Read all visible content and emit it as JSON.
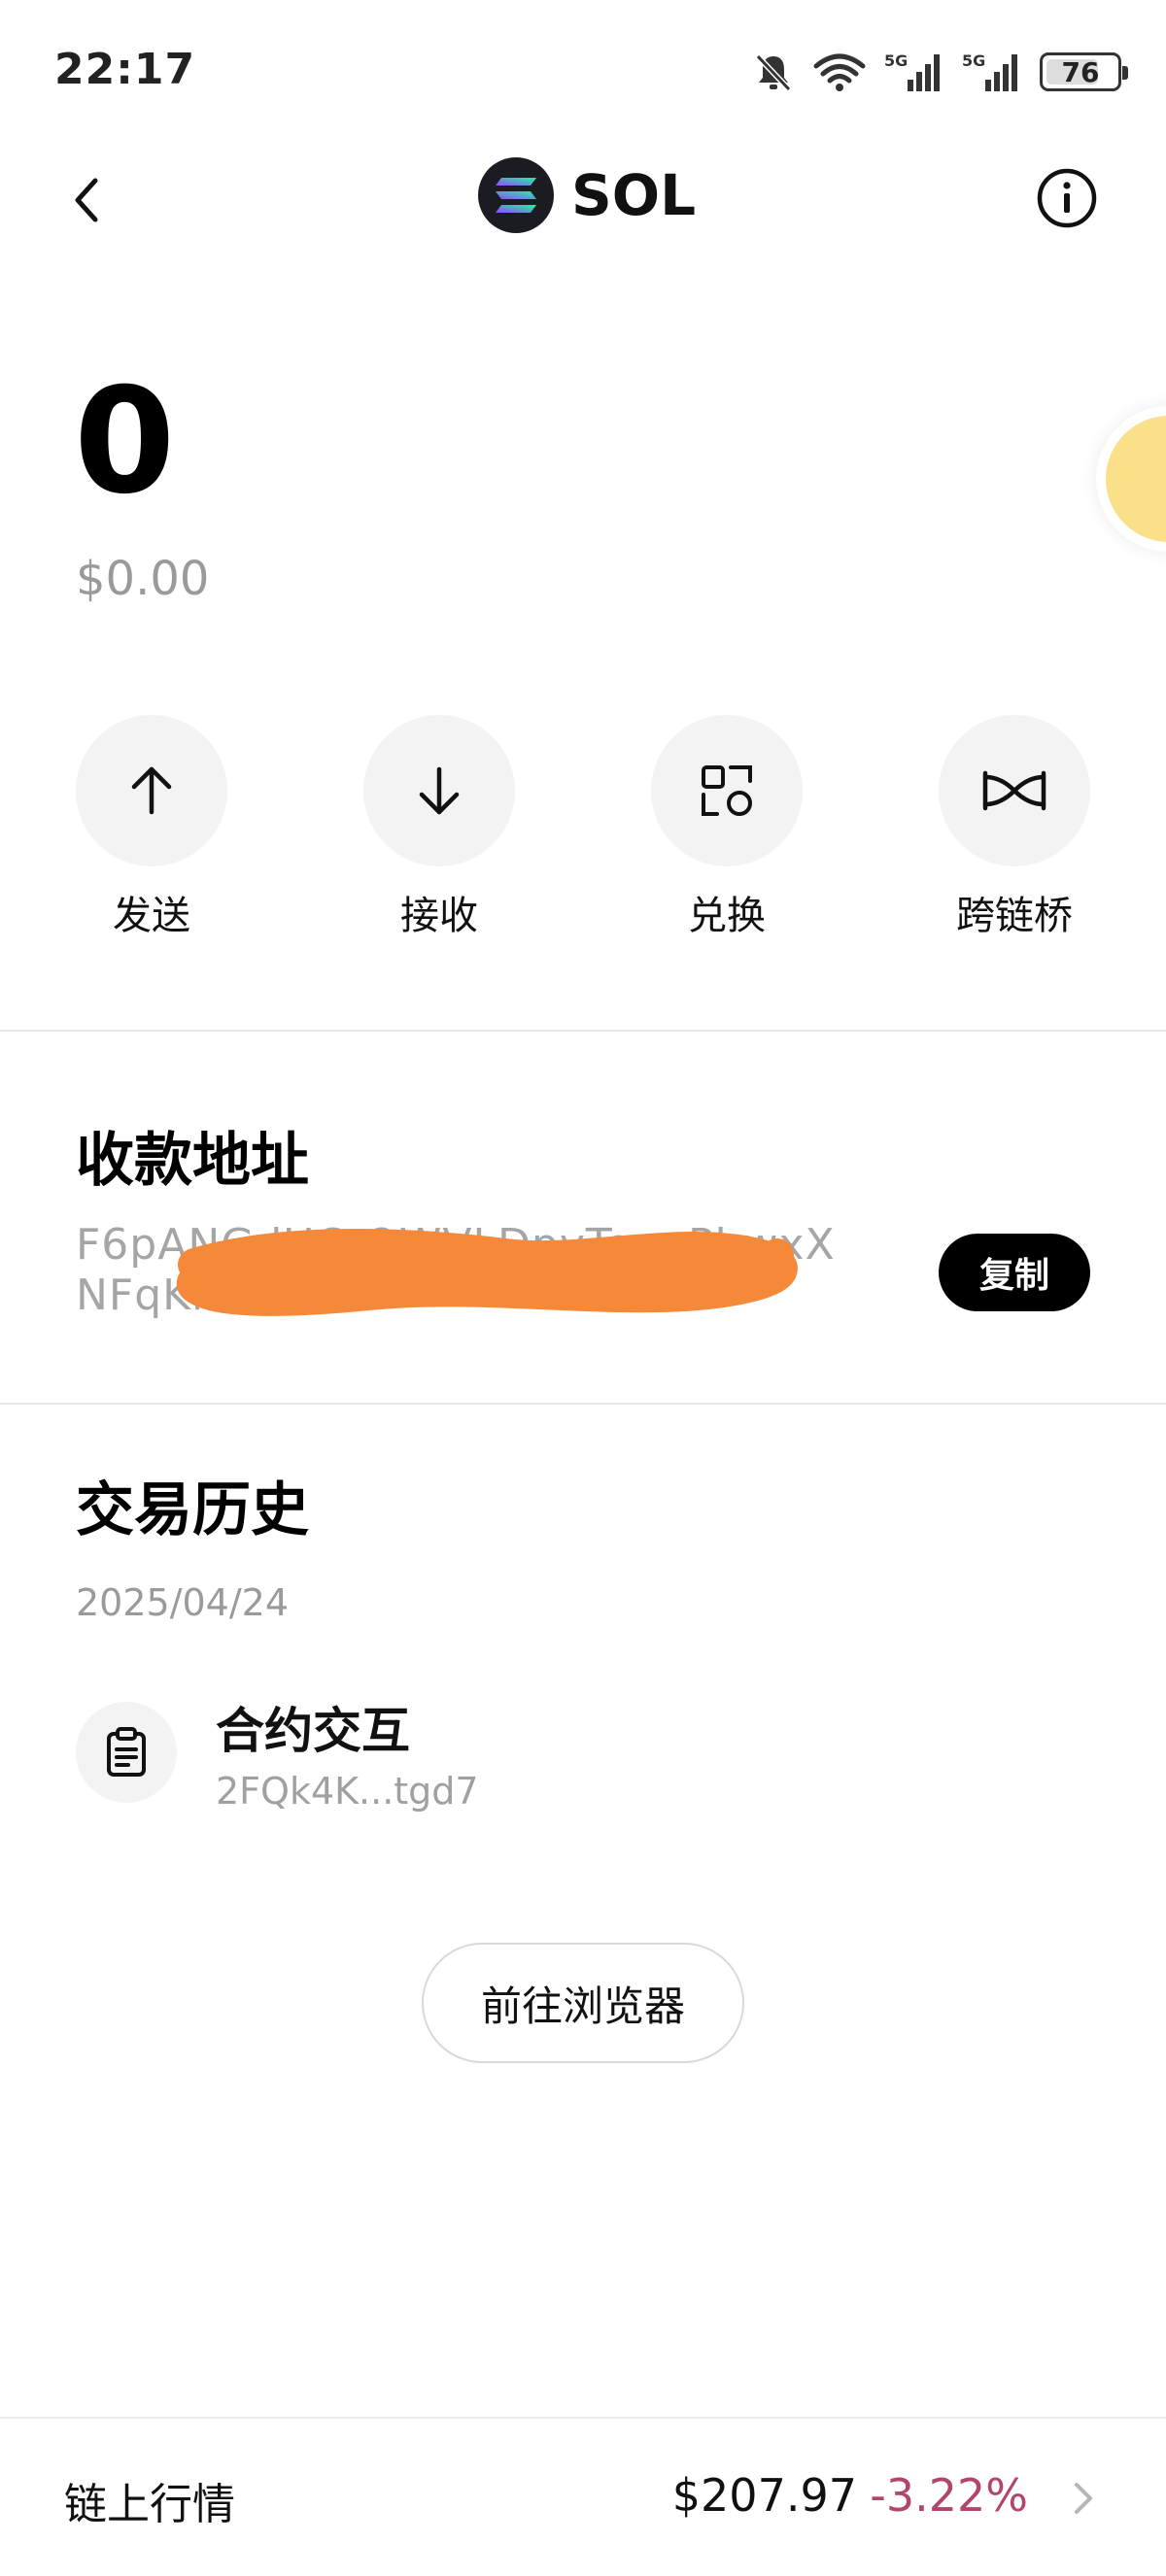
{
  "status_bar": {
    "time": "22:17",
    "battery": "76",
    "battery_level": 0.76,
    "icons": [
      "mute-bell-icon",
      "wifi-icon",
      "signal-5g-icon",
      "signal-5g-icon"
    ]
  },
  "header": {
    "title": "SOL",
    "logo_icon": "solana-logo-icon",
    "info_icon": "info-icon"
  },
  "balance": {
    "amount": "0",
    "fiat": "$0.00"
  },
  "actions": [
    {
      "label": "发送",
      "icon": "arrow-up-icon"
    },
    {
      "label": "接收",
      "icon": "arrow-down-icon"
    },
    {
      "label": "兑换",
      "icon": "swap-icon"
    },
    {
      "label": "跨链桥",
      "icon": "bridge-icon"
    }
  ],
  "address_section": {
    "title": "收款地址",
    "line1": "F6pANGdUCrQWVLDpyTogoPbwxX",
    "line2": "NFqKl9Ahm",
    "copy_label": "复制"
  },
  "history": {
    "title": "交易历史",
    "date": "2025/04/24",
    "items": [
      {
        "title": "合约交互",
        "hash": "2FQk4K...tgd7",
        "icon": "contract-icon"
      }
    ],
    "browser_button": "前往浏览器"
  },
  "market": {
    "label": "链上行情",
    "price": "$207.97",
    "change": "-3.22%",
    "colors": {
      "negative": "#b2456e"
    }
  }
}
